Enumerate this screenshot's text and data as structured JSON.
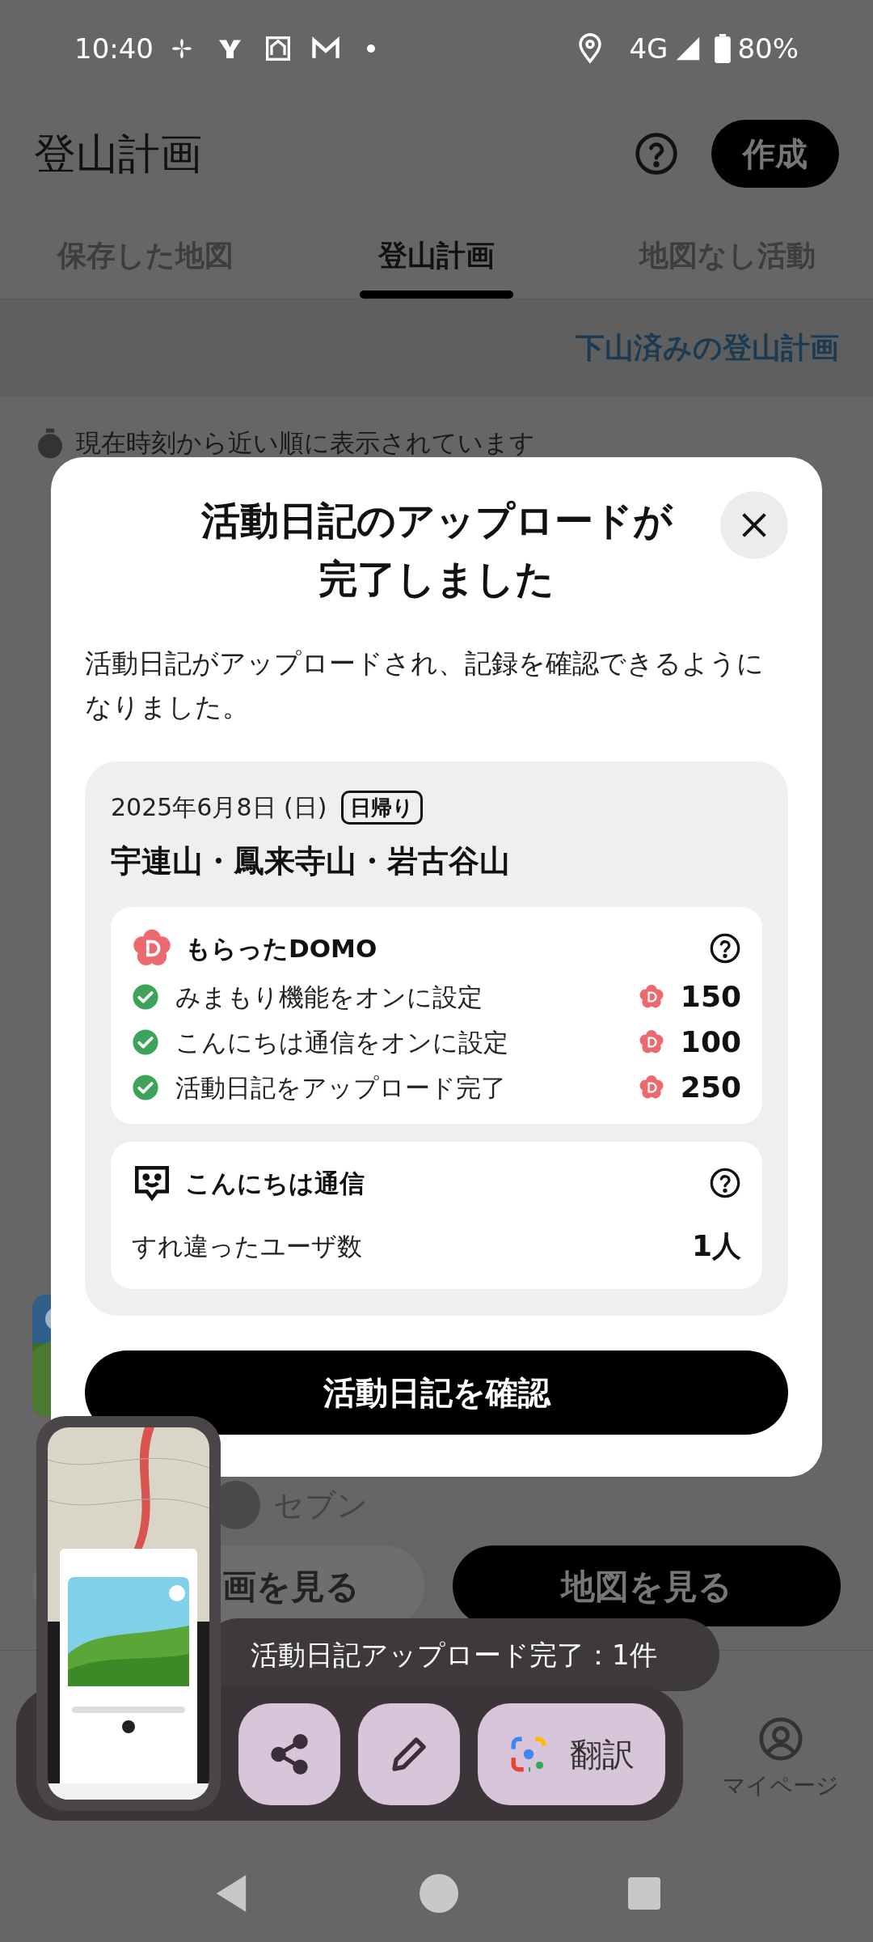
{
  "status_bar": {
    "time": "10:40",
    "network": "4G",
    "battery": "80%"
  },
  "header": {
    "title": "登山計画",
    "create_button": "作成"
  },
  "tabs": [
    {
      "label": "保存した地図",
      "selected": false
    },
    {
      "label": "登山計画",
      "selected": true
    },
    {
      "label": "地図なし活動",
      "selected": false
    }
  ],
  "completed_link": "下山済みの登山計画",
  "sort_notice": "現在時刻から近い順に表示されています",
  "plan_card": {
    "member": "セブン",
    "plan_button": "画を見る",
    "map_button": "地図を見る"
  },
  "toast": "活動日記アップロード完了：1件",
  "bottom_nav": [
    {
      "label": "マイページ"
    }
  ],
  "dialog": {
    "title_lines": [
      "活動日記のアップロードが",
      "完了しました"
    ],
    "description": "活動日記がアップロードされ、記録を確認できるようになりました。",
    "activity": {
      "date": "2025年6月8日 (日)",
      "badge": "日帰り",
      "title": "宇連山・鳳来寺山・岩古谷山"
    },
    "domo": {
      "title": "もらったDOMO",
      "items": [
        {
          "label": "みまもり機能をオンに設定",
          "points": "150",
          "checked": true
        },
        {
          "label": "こんにちは通信をオンに設定",
          "points": "100",
          "checked": true
        },
        {
          "label": "活動日記をアップロード完了",
          "points": "250",
          "checked": true
        }
      ]
    },
    "greeting": {
      "title": "こんにちは通信",
      "rows": [
        {
          "label": "すれ違ったユーザ数",
          "value": "1人"
        }
      ]
    },
    "button": "活動日記を確認"
  },
  "screenshot_actions": {
    "translate": "翻訳"
  }
}
